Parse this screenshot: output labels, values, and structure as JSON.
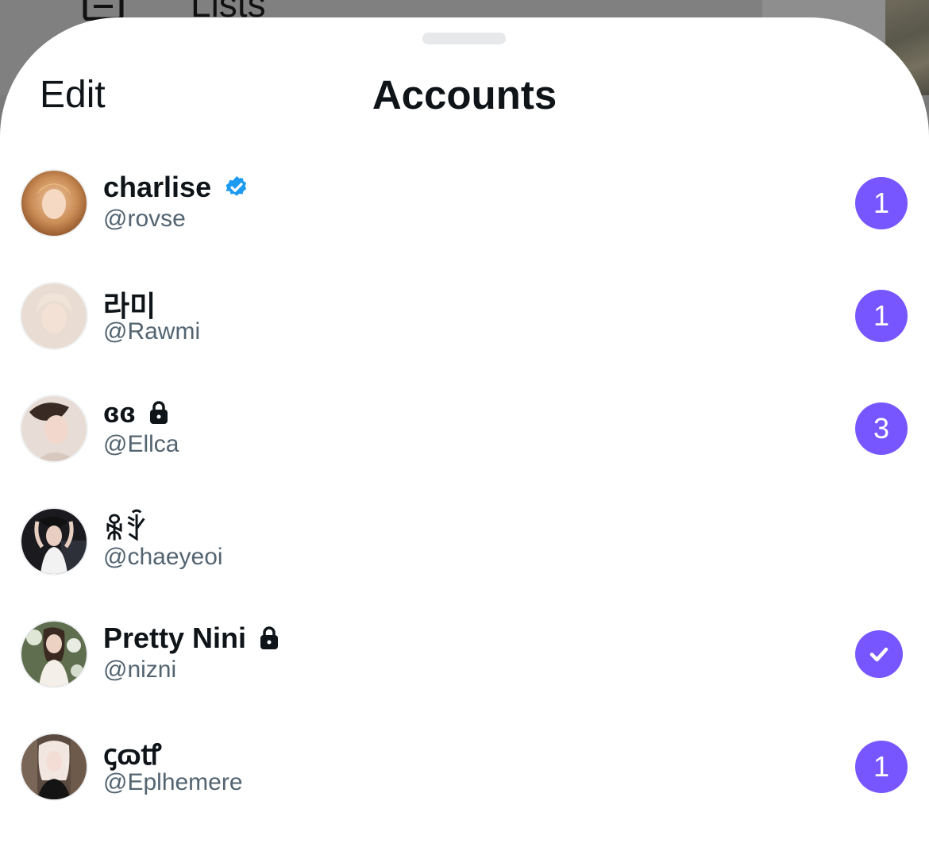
{
  "background": {
    "lists_label": "Lists",
    "lists_icon": "lists-icon"
  },
  "sheet": {
    "edit_label": "Edit",
    "title": "Accounts"
  },
  "accounts": [
    {
      "display_name": "charlise",
      "handle": "@rovse",
      "name_icon": "verified-badge-icon",
      "unread_count": "1",
      "selected": false
    },
    {
      "display_name": "라미",
      "handle": "@Rawmi",
      "name_icon": null,
      "unread_count": "1",
      "selected": false
    },
    {
      "display_name": "ɞɞ",
      "handle": "@Ellca",
      "name_icon": "lock-icon",
      "unread_count": "3",
      "selected": false
    },
    {
      "display_name": "ꆜꇫ",
      "handle": "@chaeyeoi",
      "name_icon": null,
      "unread_count": null,
      "selected": false
    },
    {
      "display_name": "Pretty Nini",
      "handle": "@nizni",
      "name_icon": "lock-icon",
      "unread_count": null,
      "selected": true
    },
    {
      "display_name": "ꞔɷꝷ",
      "handle": "@Eplhemere",
      "name_icon": null,
      "unread_count": "1",
      "selected": false
    }
  ],
  "colors": {
    "accent": "#7856ff",
    "verified": "#1d9bf0",
    "text_primary": "#0f1419",
    "text_secondary": "#536471"
  }
}
